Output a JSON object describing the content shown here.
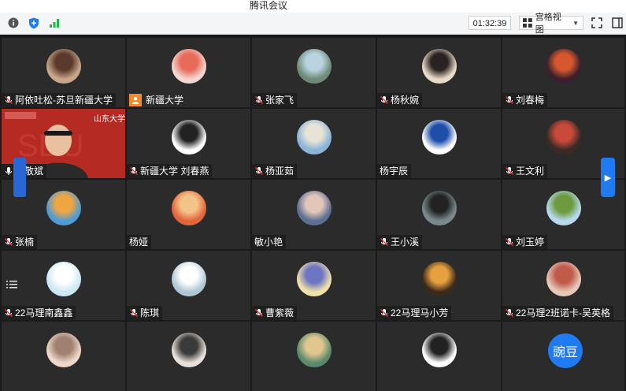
{
  "window": {
    "title": "腾讯会议"
  },
  "toolbar": {
    "timer": "01:32:39",
    "view_label": "宫格视图"
  },
  "avatar_text": "豌豆",
  "video_logo_text": "山东大学",
  "participants": [
    {
      "name": "阿依吐松-苏旦新疆大学"
    },
    {
      "name": "新疆大学"
    },
    {
      "name": "张家飞"
    },
    {
      "name": "杨秋婉"
    },
    {
      "name": "刘春梅"
    },
    {
      "name": "郑敬斌"
    },
    {
      "name": "新疆大学 刘春燕"
    },
    {
      "name": "杨亚茹"
    },
    {
      "name": "杨宇辰"
    },
    {
      "name": "王文利"
    },
    {
      "name": "张楠"
    },
    {
      "name": "杨娅"
    },
    {
      "name": "敏小艳"
    },
    {
      "name": "王小溪"
    },
    {
      "name": "刘玉婷"
    },
    {
      "name": "22马理南鑫鑫"
    },
    {
      "name": "陈琪"
    },
    {
      "name": "曹紫薇"
    },
    {
      "name": "22马理马小芳"
    },
    {
      "name": "22马理2班诺卡-吴英格"
    }
  ],
  "colors": {
    "accent": "#1e7bf2",
    "host": "#f28a2e",
    "tile": "#2b2b2b"
  }
}
